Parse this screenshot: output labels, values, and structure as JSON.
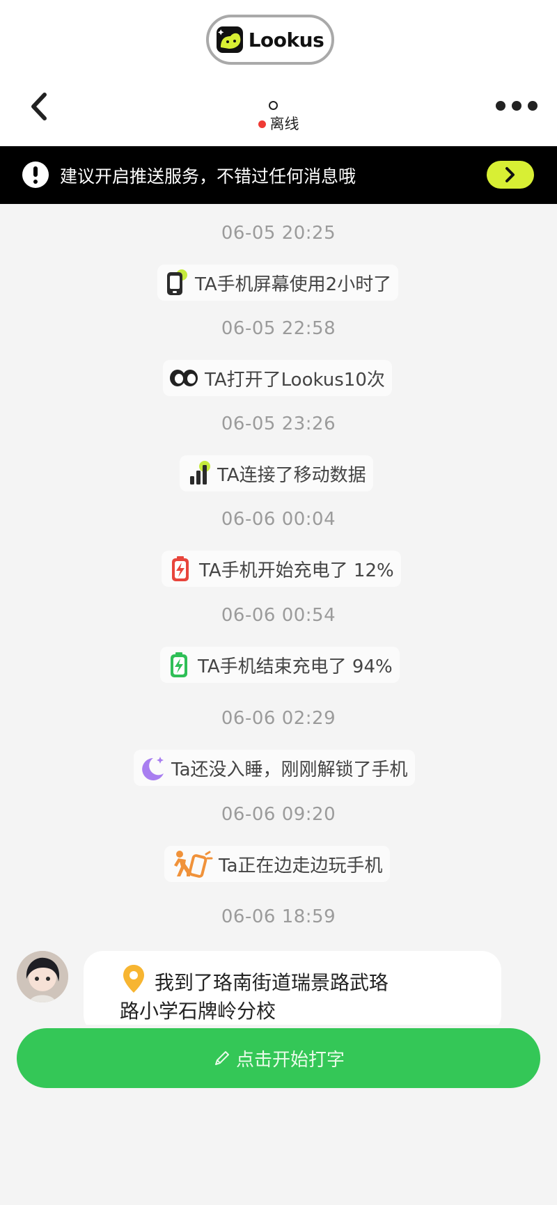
{
  "header": {
    "brand": "Lookus",
    "title": "°",
    "status": "离线",
    "status_color": "#ef3b35"
  },
  "banner": {
    "text": "建议开启推送服务，不错过任何消息哦",
    "action_color": "#d8ef34"
  },
  "feed": [
    {
      "time": "06-05 20:25",
      "text": "TA手机屏幕使用2小时了",
      "icon": "phone-screen-icon"
    },
    {
      "time": "06-05 22:58",
      "text": "TA打开了Lookus10次",
      "icon": "eyes-icon"
    },
    {
      "time": "06-05 23:26",
      "text": "TA连接了移动数据",
      "icon": "signal-bars-icon"
    },
    {
      "time": "06-06 00:04",
      "text": "TA手机开始充电了 12%",
      "icon": "battery-low-icon"
    },
    {
      "time": "06-06 00:54",
      "text": "TA手机结束充电了 94%",
      "icon": "battery-full-icon"
    },
    {
      "time": "06-06 02:29",
      "text": "Ta还没入睡，刚刚解锁了手机",
      "icon": "moon-icon"
    },
    {
      "time": "06-06 09:20",
      "text": "Ta正在边走边玩手机",
      "icon": "walking-phone-icon"
    }
  ],
  "last_message": {
    "time": "06-06 18:59",
    "line1": "我到了珞南街道瑞景路武珞",
    "line2": "路小学石牌岭分校",
    "icon": "location-pin-icon"
  },
  "composer": {
    "label": "点击开始打字",
    "color": "#34c757"
  }
}
